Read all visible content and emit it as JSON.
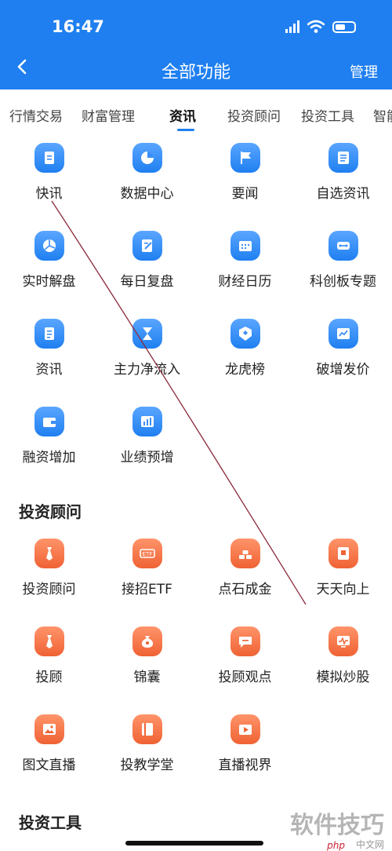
{
  "status": {
    "time": "16:47"
  },
  "header": {
    "title": "全部功能",
    "manage": "管理"
  },
  "tabs": [
    "行情交易",
    "财富管理",
    "资讯",
    "投资顾问",
    "投资工具",
    "智能"
  ],
  "news": [
    {
      "label": "快讯",
      "icon": "document-icon"
    },
    {
      "label": "数据中心",
      "icon": "pie-chart-icon"
    },
    {
      "label": "要闻",
      "icon": "flag-icon"
    },
    {
      "label": "自选资讯",
      "icon": "news-icon"
    },
    {
      "label": "实时解盘",
      "icon": "pie-split-icon"
    },
    {
      "label": "每日复盘",
      "icon": "edit-note-icon"
    },
    {
      "label": "财经日历",
      "icon": "calendar-icon"
    },
    {
      "label": "科创板专题",
      "icon": "chip-icon"
    },
    {
      "label": "资讯",
      "icon": "document-icon"
    },
    {
      "label": "主力净流入",
      "icon": "hourglass-icon"
    },
    {
      "label": "龙虎榜",
      "icon": "dragon-badge-icon"
    },
    {
      "label": "破增发价",
      "icon": "trend-chart-icon"
    },
    {
      "label": "融资增加",
      "icon": "wallet-icon"
    },
    {
      "label": "业绩预增",
      "icon": "bar-chart-icon"
    }
  ],
  "advisor_section": {
    "title": "投资顾问"
  },
  "advisor": [
    {
      "label": "投资顾问",
      "icon": "tie-icon"
    },
    {
      "label": "接招ETF",
      "icon": "etf-icon"
    },
    {
      "label": "点石成金",
      "icon": "gold-bars-icon"
    },
    {
      "label": "天天向上",
      "icon": "doc-frame-icon"
    },
    {
      "label": "投顾",
      "icon": "tie-icon"
    },
    {
      "label": "锦囊",
      "icon": "money-bag-icon"
    },
    {
      "label": "投顾观点",
      "icon": "chat-icon"
    },
    {
      "label": "模拟炒股",
      "icon": "monitor-icon"
    },
    {
      "label": "图文直播",
      "icon": "image-icon"
    },
    {
      "label": "投教学堂",
      "icon": "book-icon"
    },
    {
      "label": "直播视界",
      "icon": "play-tv-icon"
    }
  ],
  "tools_section": {
    "title": "投资工具"
  },
  "watermark": {
    "text": "软件技巧",
    "small": "中文网",
    "logo": "php"
  },
  "colors": {
    "brand": "#1f7ff0",
    "orange": "#ef6234"
  }
}
